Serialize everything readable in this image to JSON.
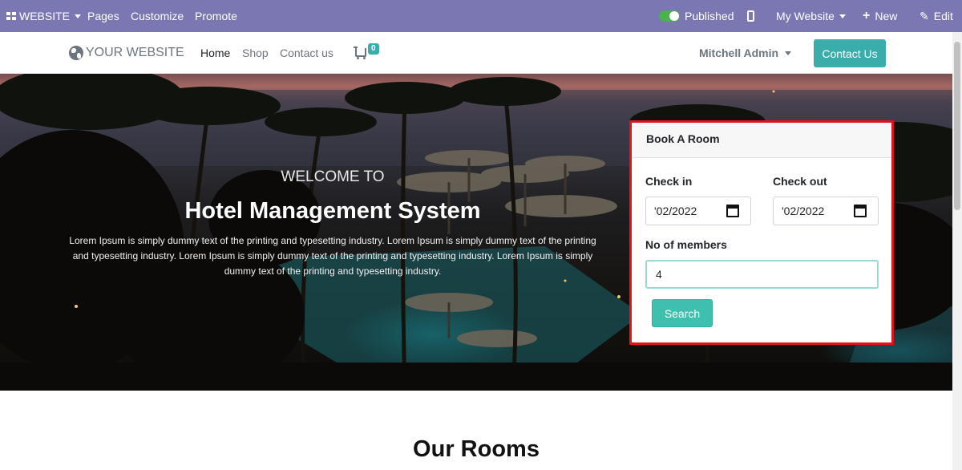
{
  "topbar": {
    "website_menu": "WEBSITE",
    "pages": "Pages",
    "customize": "Customize",
    "promote": "Promote",
    "published": "Published",
    "my_website": "My Website",
    "new": "New",
    "edit": "Edit"
  },
  "navbar": {
    "brand": "YOUR WEBSITE",
    "links": [
      "Home",
      "Shop",
      "Contact us"
    ],
    "cart_count": "0",
    "user": "Mitchell Admin",
    "contact_button": "Contact Us"
  },
  "hero": {
    "welcome": "WELCOME TO",
    "title": "Hotel Management System",
    "description": "Lorem Ipsum is simply dummy text of the printing and typesetting industry. Lorem Ipsum is simply dummy text of the printing and typesetting industry. Lorem Ipsum is simply dummy text of the printing and typesetting industry. Lorem Ipsum is simply dummy text of the printing and typesetting industry."
  },
  "booking": {
    "title": "Book A Room",
    "check_in_label": "Check in",
    "check_in_value": "'02/2022",
    "check_out_label": "Check out",
    "check_out_value": "'02/2022",
    "members_label": "No of members",
    "members_value": "4",
    "search_button": "Search"
  },
  "rooms": {
    "title": "Our Rooms"
  },
  "colors": {
    "topbar": "#7b77b3",
    "accent": "#3aadaa",
    "highlight_border": "#e0121b"
  }
}
